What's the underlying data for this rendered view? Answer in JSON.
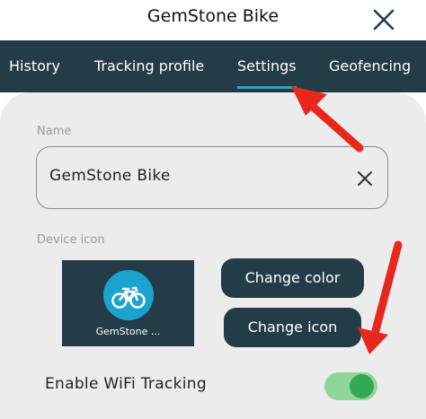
{
  "header": {
    "title": "GemStone Bike",
    "close_icon": "close-icon"
  },
  "tabs": [
    {
      "label": "History",
      "selected": false
    },
    {
      "label": "Tracking profile",
      "selected": false
    },
    {
      "label": "Settings",
      "selected": true
    },
    {
      "label": "Geofencing",
      "selected": false
    }
  ],
  "settings": {
    "name_label": "Name",
    "name_value": "GemStone Bike",
    "device_icon_label": "Device icon",
    "device_icon": "bicycle-icon",
    "device_preview_name": "GemStone ...",
    "change_color_label": "Change color",
    "change_icon_label": "Change icon",
    "wifi_label": "Enable WiFi Tracking",
    "wifi_enabled": true
  },
  "colors": {
    "tab_bar": "#243b48",
    "tab_underline": "#2ba7c8",
    "icon_circle": "#1aa3cf",
    "toggle_track": "#8fd69a",
    "toggle_knob": "#34a853",
    "annotation_arrow": "#e8281e"
  }
}
